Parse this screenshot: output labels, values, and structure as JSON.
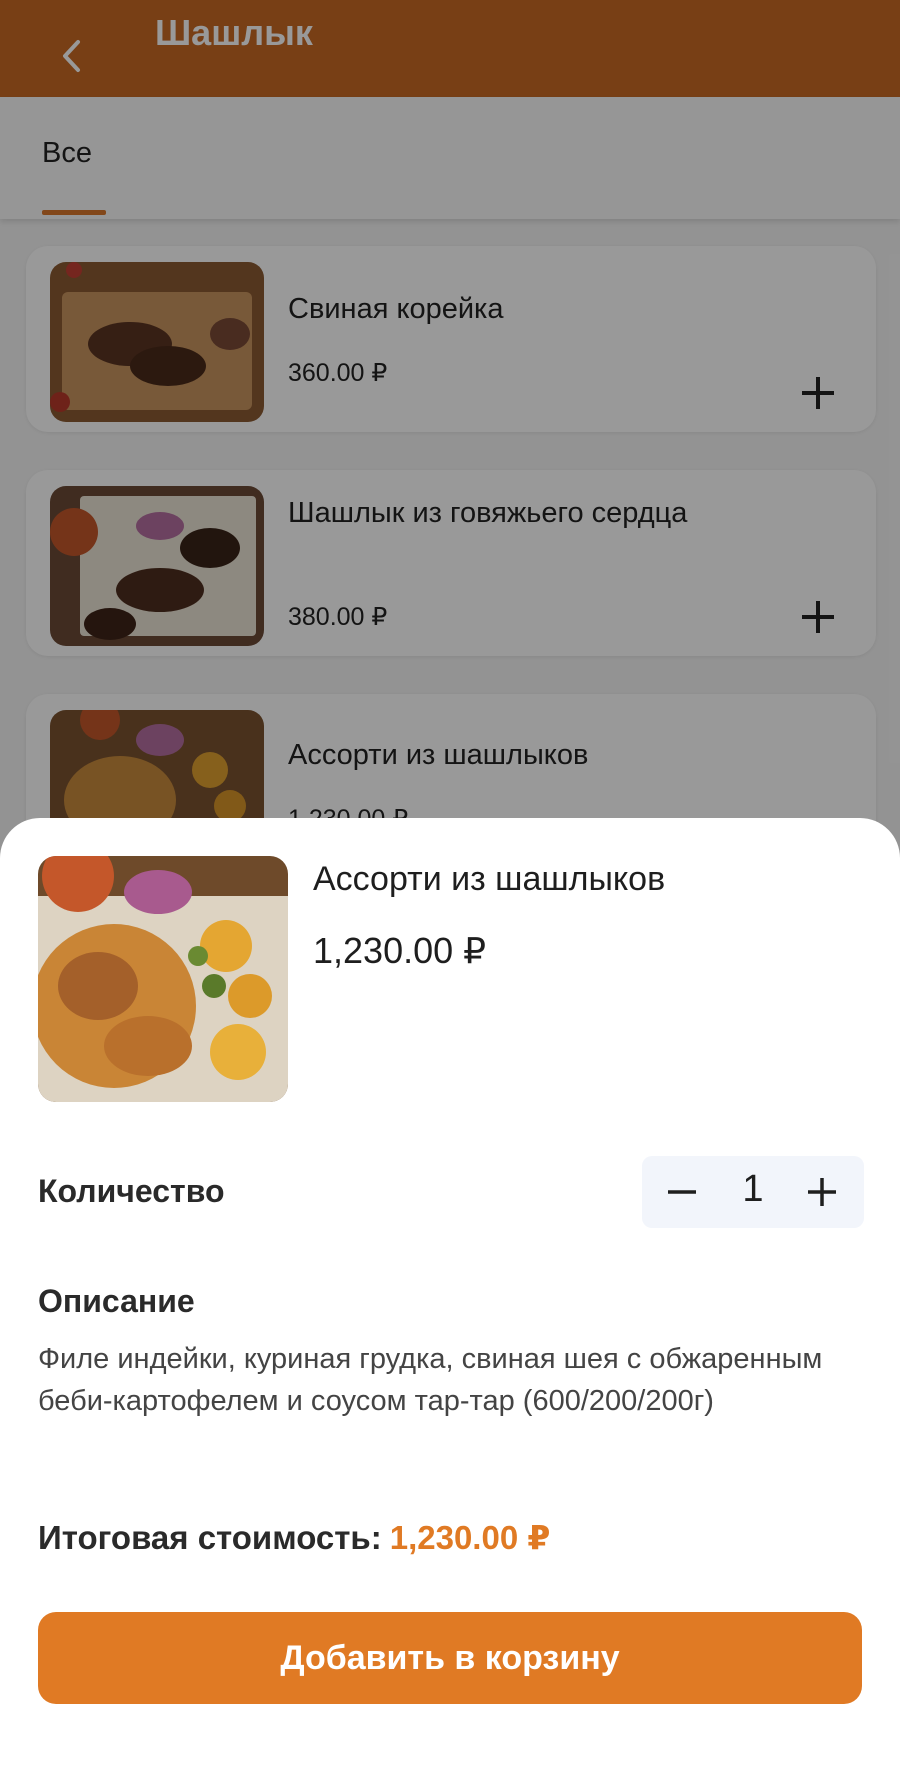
{
  "header": {
    "title": "Шашлык",
    "back_icon": "chevron-left-icon"
  },
  "tabs": [
    {
      "label": "Все",
      "active": true
    }
  ],
  "menu": {
    "items": [
      {
        "name": "Свиная корейка",
        "price": "360.00 ₽"
      },
      {
        "name": "Шашлык из говяжьего сердца",
        "price": "380.00 ₽"
      },
      {
        "name": "Ассорти из шашлыков",
        "price": "1,230.00 ₽"
      }
    ]
  },
  "sheet": {
    "name": "Ассорти из шашлыков",
    "price": "1,230.00 ₽",
    "quantity_label": "Количество",
    "quantity": "1",
    "minus_symbol": "−",
    "plus_symbol": "+",
    "description_label": "Описание",
    "description": "Филе индейки, куриная грудка, свиная шея с обжаренным беби-картофелем и соусом тар-тар (600/200/200г)",
    "total_label": "Итоговая стоимость:",
    "total_value": "1,230.00 ₽",
    "add_button": "Добавить в корзину"
  },
  "colors": {
    "brand": "#e07a24",
    "appbar": "#c96a24",
    "stepper_bg": "#f2f5fb"
  }
}
